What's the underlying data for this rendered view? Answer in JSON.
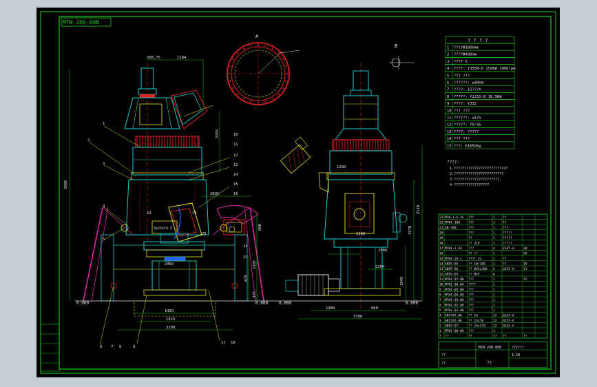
{
  "drawing_number": "MTW-200-00B",
  "view_label": "A",
  "detail_label": "B",
  "colors": {
    "frame": "#1ecb1e",
    "yellow": "#e6e61e",
    "red": "#e02020",
    "cyan": "#1ecbcb",
    "white": "#e8e8e8",
    "magenta": "#e020a0",
    "blue": "#2a5cff",
    "background": "#000000",
    "app_chrome": "#c4cdd4"
  },
  "spec_table": {
    "title": "? ? ? ?",
    "rows": [
      {
        "n": "1",
        "t": "????Φ1800mm"
      },
      {
        "n": "2",
        "t": "????Φ480mm"
      },
      {
        "n": "3",
        "t": "???? 5"
      },
      {
        "n": "4",
        "t": "????: Y355M-6  250KW  1000rpm"
      },
      {
        "n": "5",
        "t": "??? ???"
      },
      {
        "n": "6",
        "t": "??????: ≤40mm"
      },
      {
        "n": "7",
        "t": "????: 15??/h"
      },
      {
        "n": "8",
        "t": "?????: Y225S-8  18.5KW"
      },
      {
        "n": "9",
        "t": "????: YJ32"
      },
      {
        "n": "10",
        "t": "??? ???"
      },
      {
        "n": "11",
        "t": "??????: ≤12%"
      },
      {
        "n": "12",
        "t": "?????: 70-95"
      },
      {
        "n": "13",
        "t": "????: ?????"
      },
      {
        "n": "14",
        "t": "??? ???"
      },
      {
        "n": "15",
        "t": "???: 61650kg"
      }
    ]
  },
  "tech_notes": {
    "title": "????:",
    "lines": [
      "1.??????????????????????????",
      "2.????????????????????????",
      "3.??????????????????????",
      "4.?????????????????"
    ]
  },
  "parts_list": {
    "rows": [
      {
        "n": "23",
        "code": "MTW-1-6.3S",
        "name": "???",
        "qty": "1",
        "mat": "??",
        "wt": ""
      },
      {
        "n": "22",
        "code": "MTW1-100",
        "name": "???",
        "qty": "1",
        "mat": "??",
        "wt": ""
      },
      {
        "n": "21",
        "code": "GB-500",
        "name": "???",
        "qty": "1",
        "mat": "???",
        "wt": ""
      },
      {
        "n": "20",
        "code": "",
        "name": "???",
        "qty": "1",
        "mat": "?????",
        "wt": ""
      },
      {
        "n": "19",
        "code": "",
        "name": "??",
        "qty": "1",
        "mat": "?????",
        "wt": ""
      },
      {
        "n": "18",
        "code": "",
        "name": "?? 310",
        "qty": "1",
        "mat": "?????",
        "wt": ""
      },
      {
        "n": "17",
        "code": "MTW1-1-34",
        "name": "???",
        "qty": "4",
        "mat": "ZG35-A",
        "wt": "30"
      },
      {
        "n": "16",
        "code": "",
        "name": "?? ??",
        "qty": "1",
        "mat": "",
        "wt": "34"
      },
      {
        "n": "15",
        "code": "MTW1-2S-1",
        "name": "???? 32",
        "qty": "1",
        "mat": "??",
        "wt": ""
      },
      {
        "n": "14",
        "code": "GB95-85",
        "name": "?? 10/100",
        "qty": "1",
        "mat": "??",
        "wt": "18"
      },
      {
        "n": "13",
        "code": "GB95-86",
        "name": "?? M24x300",
        "qty": "4",
        "mat": "Q235-A",
        "wt": "21"
      },
      {
        "n": "12",
        "code": "GB95-85",
        "name": "?? M24",
        "qty": "4",
        "mat": "",
        "wt": ""
      },
      {
        "n": "11",
        "code": "MTW1-07-00",
        "name": "???",
        "qty": "1",
        "mat": "",
        "wt": "32"
      },
      {
        "n": "10",
        "code": "MTW1-06-00",
        "name": "????",
        "qty": "1",
        "mat": "",
        "wt": ""
      },
      {
        "n": "9",
        "code": "MTW1-05-00",
        "name": "???",
        "qty": "1",
        "mat": "",
        "wt": ""
      },
      {
        "n": "8",
        "code": "MTW1-04-00",
        "name": "???",
        "qty": "1",
        "mat": "",
        "wt": ""
      },
      {
        "n": "7",
        "code": "MTW1-03-00",
        "name": "???",
        "qty": "1",
        "mat": "",
        "wt": ""
      },
      {
        "n": "6",
        "code": "MTW1-02-00",
        "name": "???",
        "qty": "1",
        "mat": "",
        "wt": ""
      },
      {
        "n": "5",
        "code": "MTW1-01-00",
        "name": "???",
        "qty": "1",
        "mat": "",
        "wt": ""
      },
      {
        "n": "4",
        "code": "GB5782-86",
        "name": "?? 24",
        "qty": "12",
        "mat": "Q235-A",
        "wt": ""
      },
      {
        "n": "3",
        "code": "GB5782-86",
        "name": "?? 24x70",
        "qty": "12",
        "mat": "Q235-A",
        "wt": ""
      },
      {
        "n": "2",
        "code": "GB93-87",
        "name": "?? 24x270",
        "qty": "12",
        "mat": "Q235-A",
        "wt": ""
      },
      {
        "n": "1",
        "code": "MTW1-00-08",
        "name": "???",
        "qty": "1",
        "mat": "",
        "wt": ""
      }
    ],
    "header": [
      "?",
      "??",
      "??",
      "??",
      "??",
      "??"
    ]
  },
  "title_block": {
    "drawing_id": "MTW 200-00B",
    "name": "??????",
    "scale": "1:20",
    "sheet": "??",
    "designer": "??",
    "checker": "??"
  },
  "dimensions_front": {
    "top_a": "208.75",
    "top_b": "1184",
    "h_left": "3500",
    "h_right1": "2155",
    "h_right2": "8",
    "w1": "2835",
    "w2": "1420",
    "w3": "1910",
    "w4": "3200",
    "w5": "2350",
    "h_low": "1307",
    "h_low2": "875",
    "h_low3": "375",
    "h_low4": "900"
  },
  "dimensions_side": {
    "d1": "1290",
    "d2": "2110",
    "d3": "960",
    "d4": "1160",
    "d5": "1980",
    "d6": "1154",
    "d7": "1190",
    "d8": "1160",
    "d9": "3390",
    "d10": "3278",
    "d11": "1900",
    "d12": "1049"
  },
  "callouts_front": [
    "1",
    "2",
    "3",
    "4",
    "5",
    "6",
    "7",
    "8",
    "9",
    "10",
    "11",
    "12",
    "13",
    "14",
    "15",
    "16",
    "17",
    "18",
    "19",
    "20",
    "21",
    "22",
    "23"
  ]
}
